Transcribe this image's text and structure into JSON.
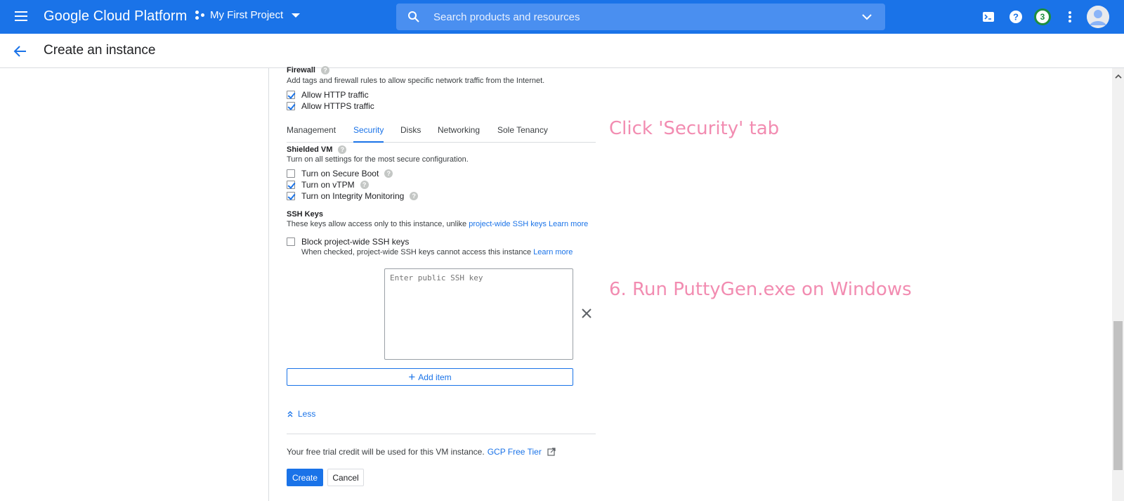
{
  "topbar": {
    "brand": "Google Cloud Platform",
    "project": "My First Project",
    "search_placeholder": "Search products and resources",
    "notification_count": "3"
  },
  "header": {
    "title": "Create an instance"
  },
  "firewall": {
    "title": "Firewall",
    "description": "Add tags and firewall rules to allow specific network traffic from the Internet.",
    "http_label": "Allow HTTP traffic",
    "https_label": "Allow HTTPS traffic",
    "http_checked": true,
    "https_checked": true
  },
  "tabs": [
    {
      "label": "Management",
      "active": false
    },
    {
      "label": "Security",
      "active": true
    },
    {
      "label": "Disks",
      "active": false
    },
    {
      "label": "Networking",
      "active": false
    },
    {
      "label": "Sole Tenancy",
      "active": false
    }
  ],
  "shielded_vm": {
    "title": "Shielded VM",
    "description": "Turn on all settings for the most secure configuration.",
    "options": [
      {
        "label": "Turn on Secure Boot",
        "checked": false
      },
      {
        "label": "Turn on vTPM",
        "checked": true
      },
      {
        "label": "Turn on Integrity Monitoring",
        "checked": true
      }
    ]
  },
  "ssh_keys": {
    "title": "SSH Keys",
    "description_prefix": "These keys allow access only to this instance, unlike",
    "project_link": "project-wide SSH keys",
    "learn_more": "Learn more",
    "block_label": "Block project-wide SSH keys",
    "block_checked": false,
    "block_hint": "When checked, project-wide SSH keys cannot access this instance",
    "block_learn_more": "Learn more",
    "key_placeholder": "Enter public SSH key",
    "add_item": "Add item"
  },
  "less_label": "Less",
  "trial": {
    "text": "Your free trial credit will be used for this VM instance.",
    "link": "GCP Free Tier"
  },
  "buttons": {
    "create": "Create",
    "cancel": "Cancel"
  },
  "annotations": {
    "security_hint": "Click 'Security' tab",
    "step6": "6. Run PuttyGen.exe on Windows"
  },
  "colors": {
    "accent": "#1a73e8",
    "annotation": "#f28cb1"
  }
}
